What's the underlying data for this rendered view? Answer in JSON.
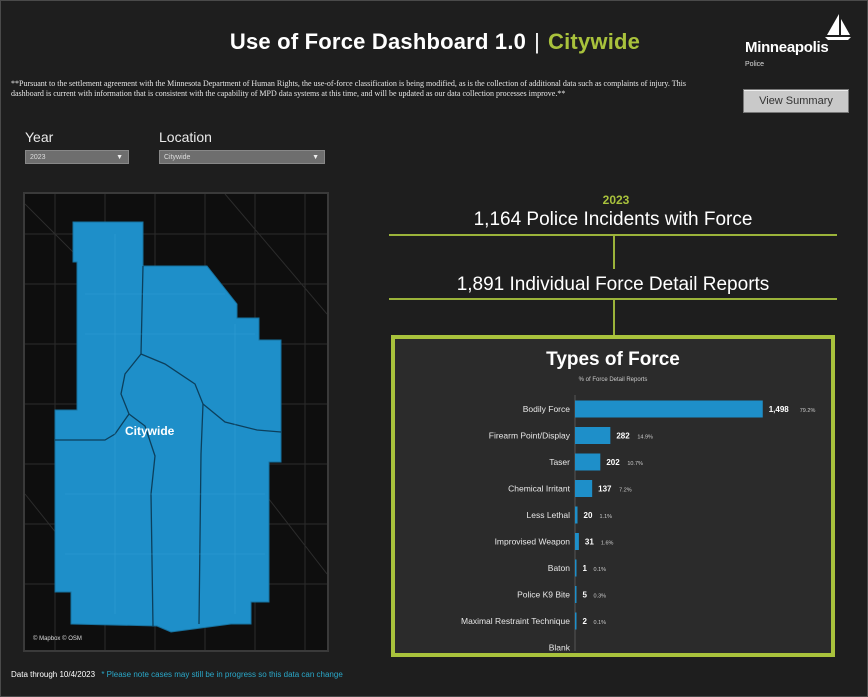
{
  "header": {
    "title": "Use of Force Dashboard 1.0",
    "separator": "|",
    "location_title": "Citywide"
  },
  "logo": {
    "name": "Minneapolis",
    "sub": "Police"
  },
  "buttons": {
    "view_summary": "View Summary"
  },
  "disclaimer": "**Pursuant to the settlement agreement with the Minnesota Department of Human Rights, the use-of-force classification is being modified, as is the collection of additional data such as complaints of injury. This dashboard is current with information that is consistent with the capability of MPD data systems at this time, and will be updated as our data collection processes improve.**",
  "filters": {
    "year_label": "Year",
    "year_value": "2023",
    "location_label": "Location",
    "location_value": "Citywide"
  },
  "map": {
    "label": "Citywide",
    "attribution": "© Mapbox  © OSM",
    "fill_color": "#1e8fc9"
  },
  "summary": {
    "year": "2023",
    "incidents": "1,164 Police Incidents with Force",
    "reports": "1,891 Individual Force Detail Reports"
  },
  "chart_data": {
    "type": "bar",
    "orientation": "horizontal",
    "title": "Types of Force",
    "subtitle": "% of Force Detail Reports",
    "categories": [
      "Bodily Force",
      "Firearm Point/Display",
      "Taser",
      "Chemical Irritant",
      "Less Lethal",
      "Improvised Weapon",
      "Baton",
      "Police K9 Bite",
      "Maximal Restraint Technique",
      "Blank"
    ],
    "values": [
      1498,
      282,
      202,
      137,
      20,
      31,
      1,
      5,
      2,
      null
    ],
    "value_labels": [
      "1,498",
      "282",
      "202",
      "137",
      "20",
      "31",
      "1",
      "5",
      "2",
      ""
    ],
    "pct_labels": [
      "79.2%",
      "14.9%",
      "10.7%",
      "7.2%",
      "1.1%",
      "1.6%",
      "0.1%",
      "0.3%",
      "0.1%",
      ""
    ],
    "bar_color": "#1e8fc9",
    "xlim": [
      0,
      1500
    ]
  },
  "footer": {
    "data_through": "Data through 10/4/2023",
    "note": "* Please note cases may still be in progress so this data can change"
  },
  "colors": {
    "accent": "#a9c23c",
    "background": "#1e1e1e",
    "map_blue": "#1e8fc9"
  }
}
